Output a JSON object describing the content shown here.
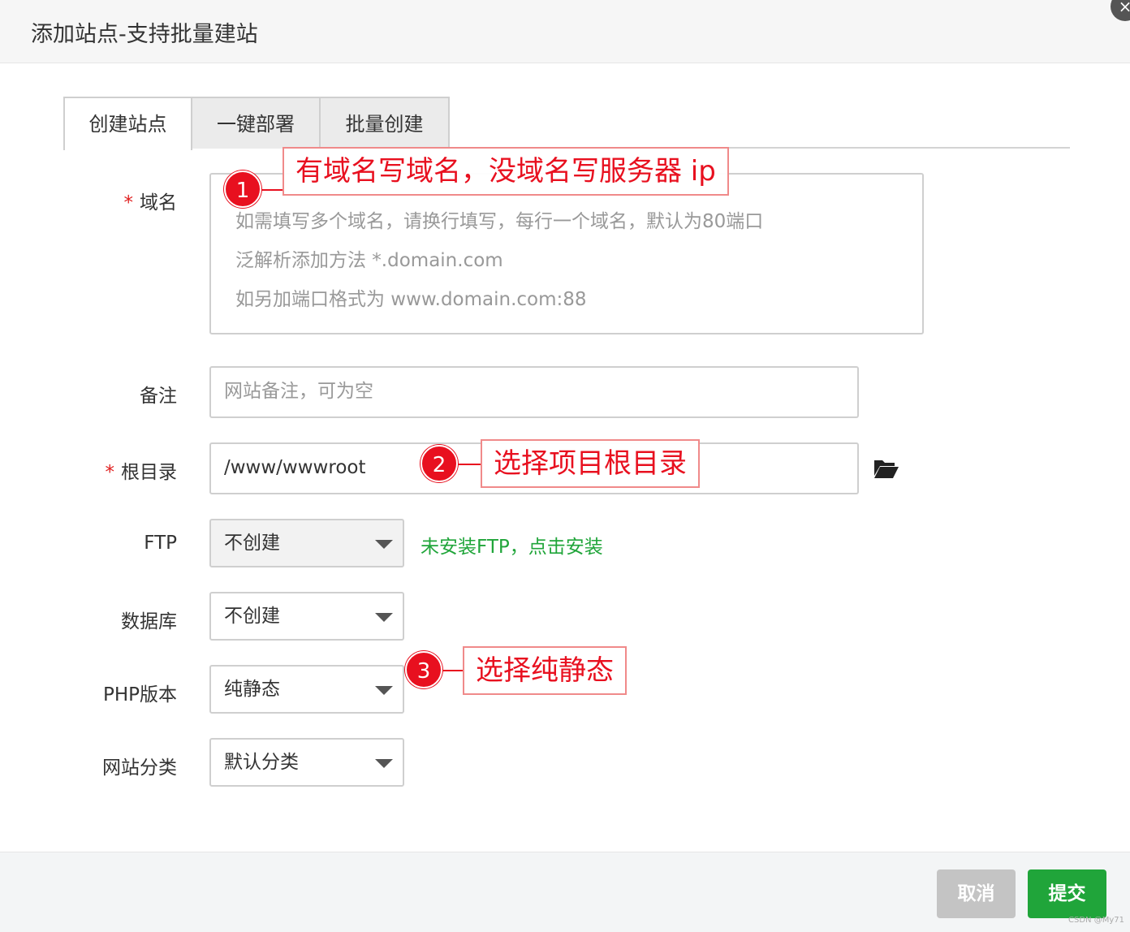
{
  "dialog": {
    "title": "添加站点-支持批量建站",
    "close_glyph": "×"
  },
  "tabs": [
    {
      "label": "创建站点",
      "active": true
    },
    {
      "label": "一键部署",
      "active": false
    },
    {
      "label": "批量创建",
      "active": false
    }
  ],
  "form": {
    "required_mark": "*",
    "domain": {
      "label": "域名",
      "placeholder_lines": [
        "如需填写多个域名，请换行填写，每行一个域名，默认为80端口",
        "泛解析添加方法 *.domain.com",
        "如另加端口格式为 www.domain.com:88"
      ]
    },
    "remark": {
      "label": "备注",
      "placeholder": "网站备注，可为空"
    },
    "root_dir": {
      "label": "根目录",
      "value": "/www/wwwroot",
      "icon": "folder-open-icon"
    },
    "ftp": {
      "label": "FTP",
      "selected": "不创建",
      "tip": "未安装FTP，点击安装"
    },
    "database": {
      "label": "数据库",
      "selected": "不创建"
    },
    "php_version": {
      "label": "PHP版本",
      "selected": "纯静态"
    },
    "site_category": {
      "label": "网站分类",
      "selected": "默认分类"
    }
  },
  "annotations": [
    {
      "number": "1",
      "text": "有域名写域名，没域名写服务器 ip"
    },
    {
      "number": "2",
      "text": "选择项目根目录"
    },
    {
      "number": "3",
      "text": "选择纯静态"
    }
  ],
  "footer": {
    "cancel_label": "取消",
    "submit_label": "提交"
  },
  "watermark": "CSDN @My71",
  "colors": {
    "accent_green": "#20a53a",
    "annotation_red": "#e8101f",
    "required_red": "#e02020"
  }
}
